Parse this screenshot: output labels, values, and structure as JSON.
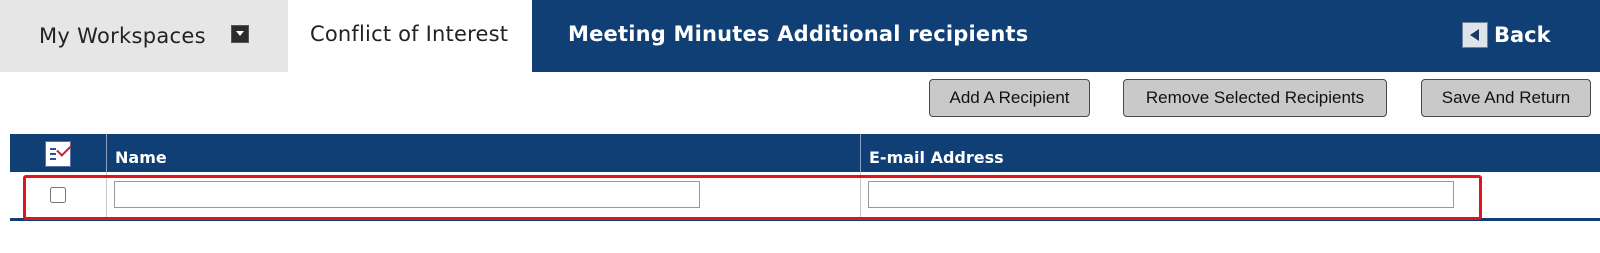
{
  "nav": {
    "workspaces_label": "My Workspaces",
    "workspaces_dropdown_icon": "chevron-down-icon",
    "active_tab_label": "Conflict of Interest"
  },
  "header": {
    "title": "Meeting Minutes Additional recipients",
    "back_label": "Back",
    "back_icon": "arrow-left-icon"
  },
  "toolbar": {
    "add_label": "Add A Recipient",
    "remove_label": "Remove Selected Recipients",
    "save_label": "Save And Return"
  },
  "grid": {
    "columns": [
      "",
      "Name",
      "E-mail Address"
    ],
    "select_all_icon": "select-all-checklist-icon",
    "rows": [
      {
        "selected": false,
        "name": "",
        "email": ""
      }
    ]
  },
  "colors": {
    "header_blue": "#0f3f74",
    "tab_gray": "#e6e6e6",
    "button_gray": "#c9c9c9",
    "highlight_red": "#e0141e"
  }
}
